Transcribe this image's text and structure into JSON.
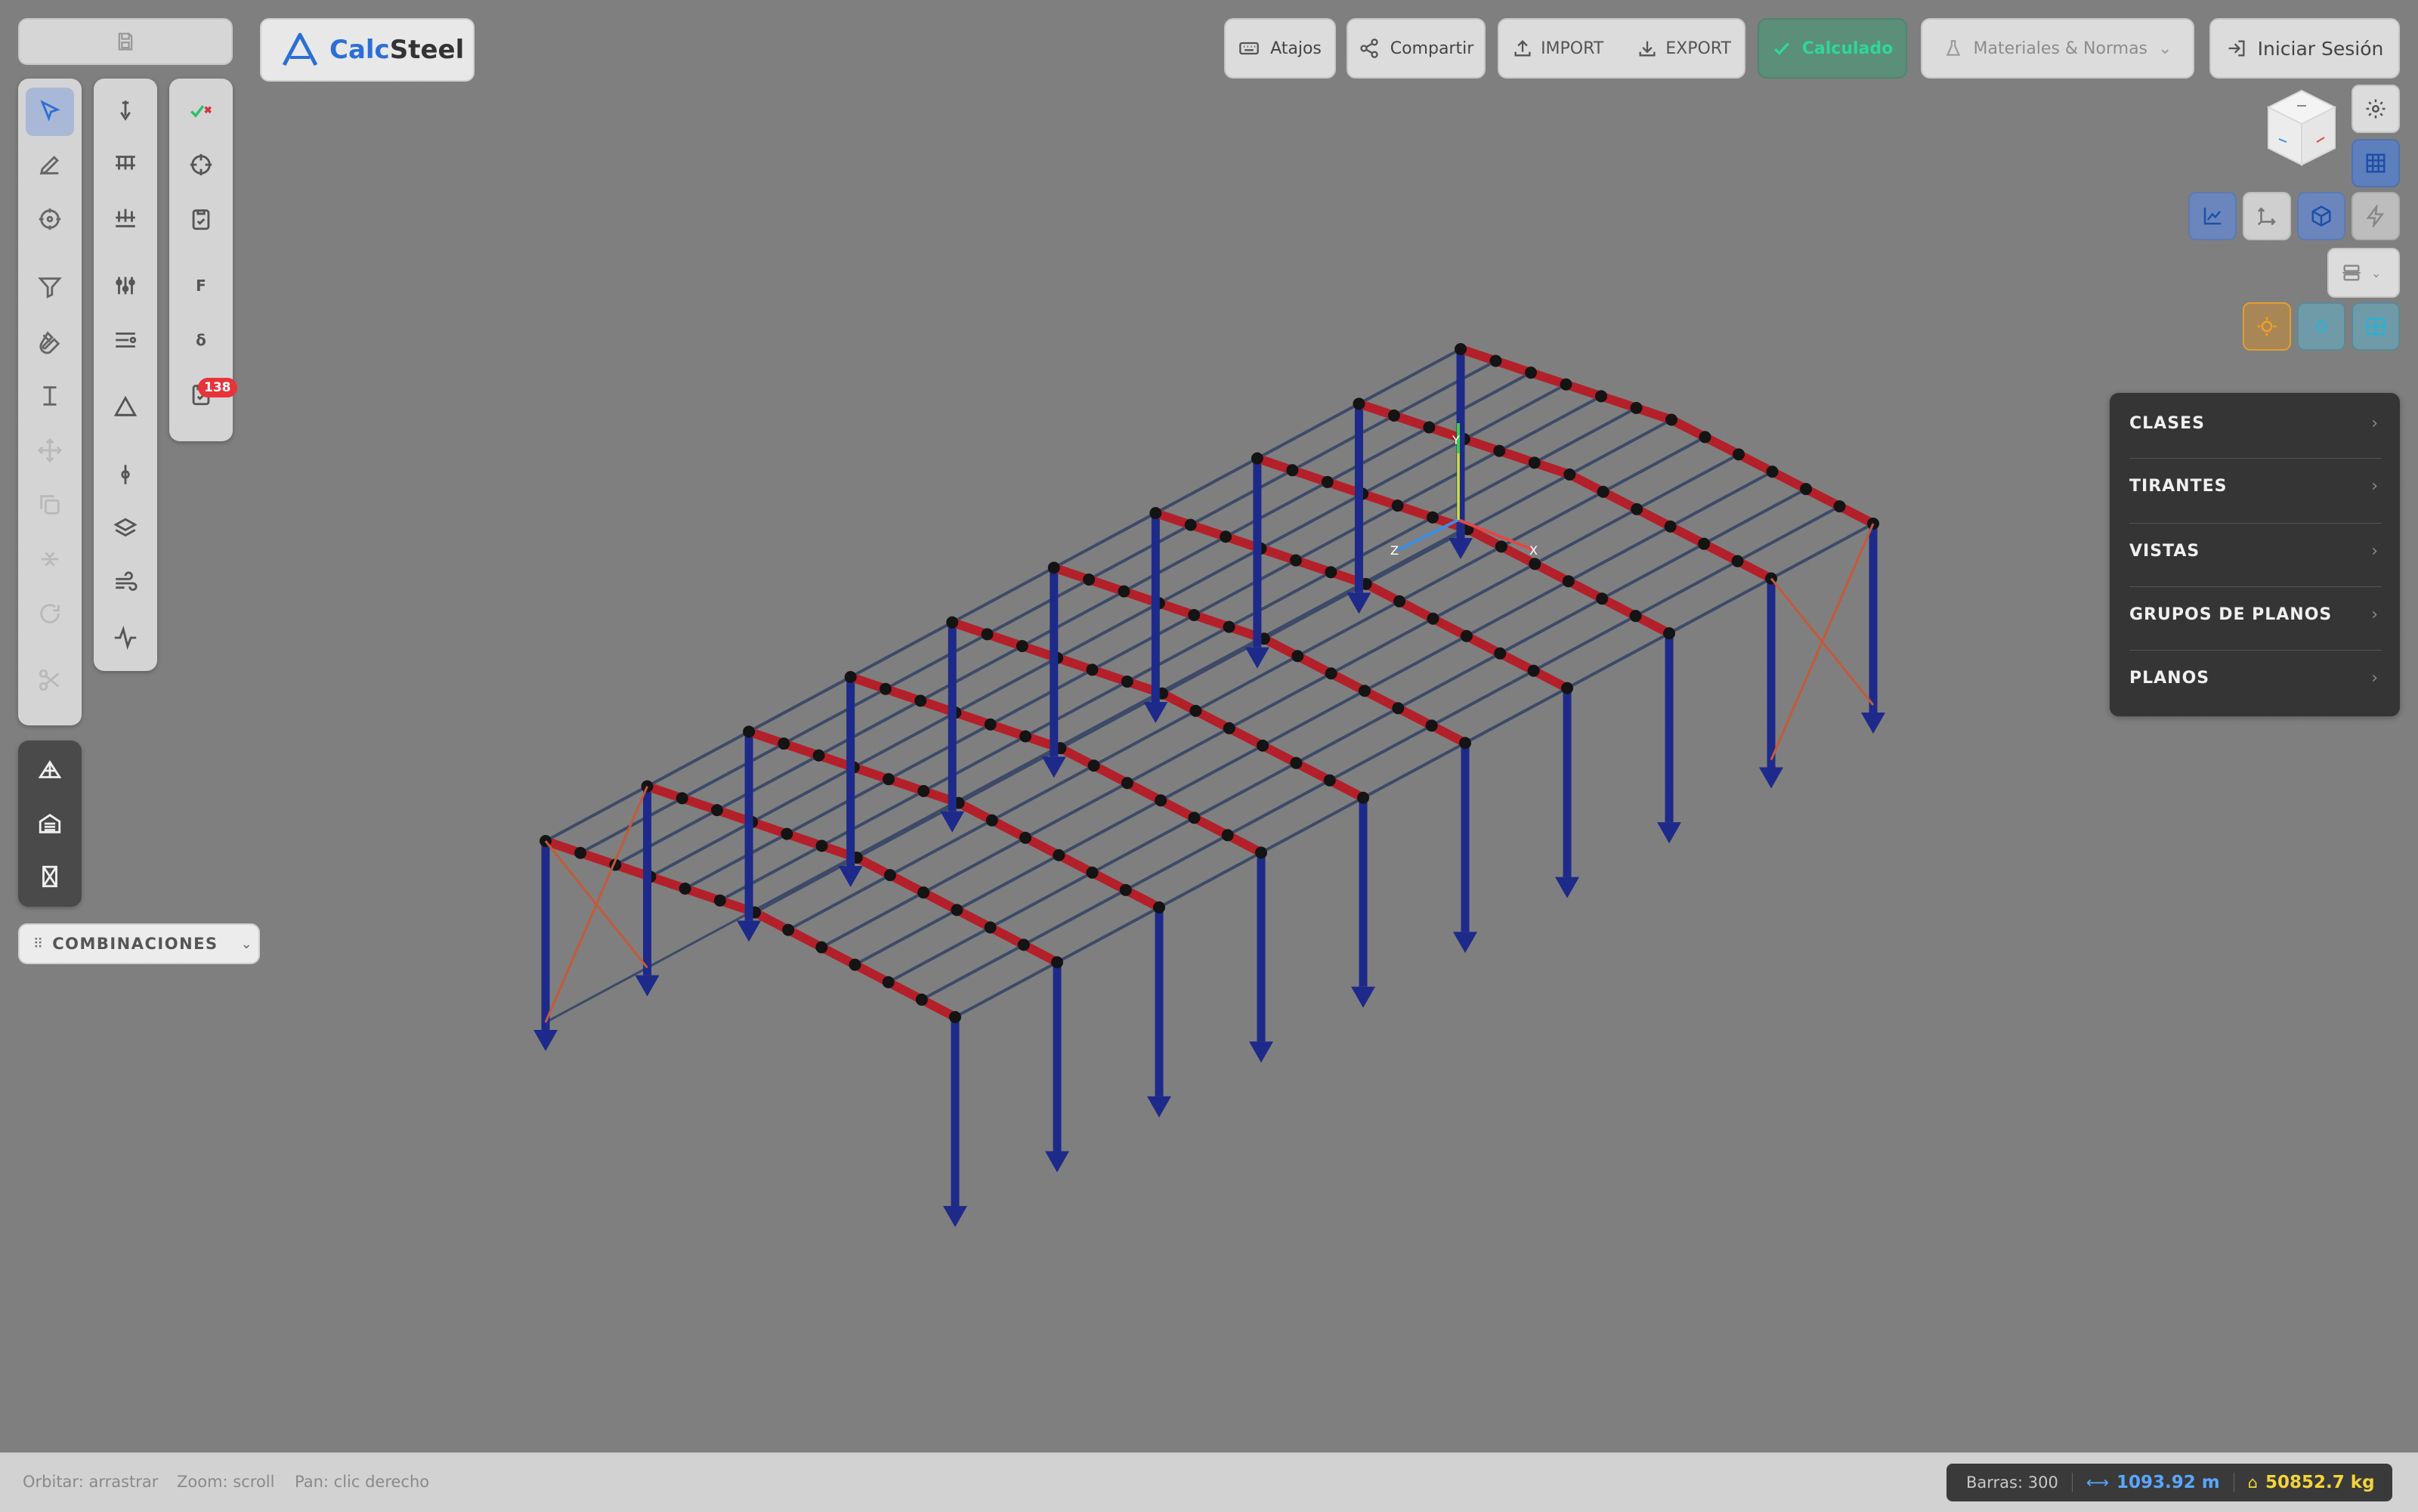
{
  "app": {
    "logo_text_calc": "Calc",
    "logo_text_steel": "Steel"
  },
  "header": {
    "atajos": "Atajos",
    "compartir": "Compartir",
    "import": "IMPORT",
    "export": "EXPORT",
    "calculado": "Calculado",
    "materiales": "Materiales & Normas",
    "login": "Iniciar Sesión"
  },
  "toolbar_right_col": {
    "force_label": "F",
    "delta_label": "δ",
    "badge_count": "138"
  },
  "combinaciones": {
    "label": "COMBINACIONES"
  },
  "axis_labels": {
    "x": "X",
    "y": "Y",
    "z": "Z"
  },
  "right_panel": {
    "items": [
      {
        "label": "CLASES"
      },
      {
        "label": "TIRANTES"
      },
      {
        "label": "VISTAS"
      },
      {
        "label": "GRUPOS DE PLANOS"
      },
      {
        "label": "PLANOS"
      }
    ]
  },
  "status_bar": {
    "orbit": "Orbitar: arrastrar",
    "zoom": "Zoom: scroll",
    "pan": "Pan: clic derecho",
    "bars": "Barras: 300",
    "length": "1093.92 m",
    "weight": "50852.7 kg"
  },
  "colors": {
    "background": "#7f7f7f",
    "column": "#1e2a8a",
    "rafter": "#b3202a",
    "purlin": "#3d4a68",
    "brace": "#c45a3a",
    "accent_blue": "#2b6fd6",
    "calculated_green": "#2fbf8a",
    "weight_yellow": "#f3d43a"
  },
  "icons": {
    "save": "save-icon",
    "select": "cursor-icon",
    "pencil": "pencil-icon",
    "settings": "gear-icon",
    "keyboard": "keyboard-icon",
    "share": "share-icon",
    "login": "login-icon"
  }
}
